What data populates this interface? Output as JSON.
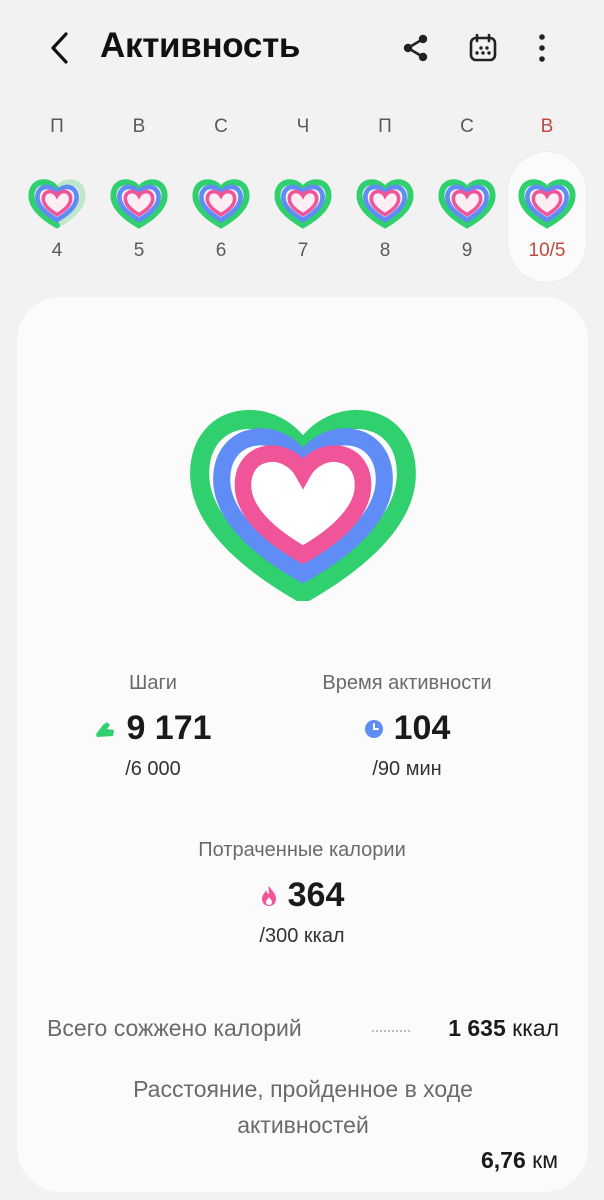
{
  "header": {
    "title": "Активность",
    "icons": [
      "back-arrow-icon",
      "share-icon",
      "calendar-icon",
      "more-vertical-icon"
    ]
  },
  "week": [
    {
      "letter": "П",
      "num": "4",
      "progress": 0.2
    },
    {
      "letter": "В",
      "num": "5",
      "progress": 1.0
    },
    {
      "letter": "С",
      "num": "6",
      "progress": 1.0
    },
    {
      "letter": "Ч",
      "num": "7",
      "progress": 1.0
    },
    {
      "letter": "П",
      "num": "8",
      "progress": 1.0
    },
    {
      "letter": "С",
      "num": "9",
      "progress": 1.0
    },
    {
      "letter": "В",
      "num": "10/5",
      "progress": 1.0,
      "selected": true
    }
  ],
  "colors": {
    "accent_selected": "#c0483f",
    "ring_green": "#2fd06d",
    "ring_blue": "#5f8cf5",
    "ring_pink": "#f0559a"
  },
  "summary": {
    "steps": {
      "label": "Шаги",
      "value": "9 171",
      "goal": "/6 000",
      "icon": "shoe-icon",
      "color": "#2fd06d"
    },
    "active_time": {
      "label": "Время активности",
      "value": "104",
      "goal": "/90 мин",
      "icon": "clock-icon",
      "color": "#5f8cf5"
    },
    "calories": {
      "label": "Потраченные калории",
      "value": "364",
      "goal": "/300 ккал",
      "icon": "flame-icon",
      "color": "#f0559a"
    }
  },
  "totals": {
    "burned_label": "Всего сожжено калорий",
    "burned_value": "1 635",
    "burned_unit": "ккал",
    "distance_label": "Расстояние, пройденное в ходе активностей",
    "distance_value": "6,76",
    "distance_unit": "км"
  }
}
